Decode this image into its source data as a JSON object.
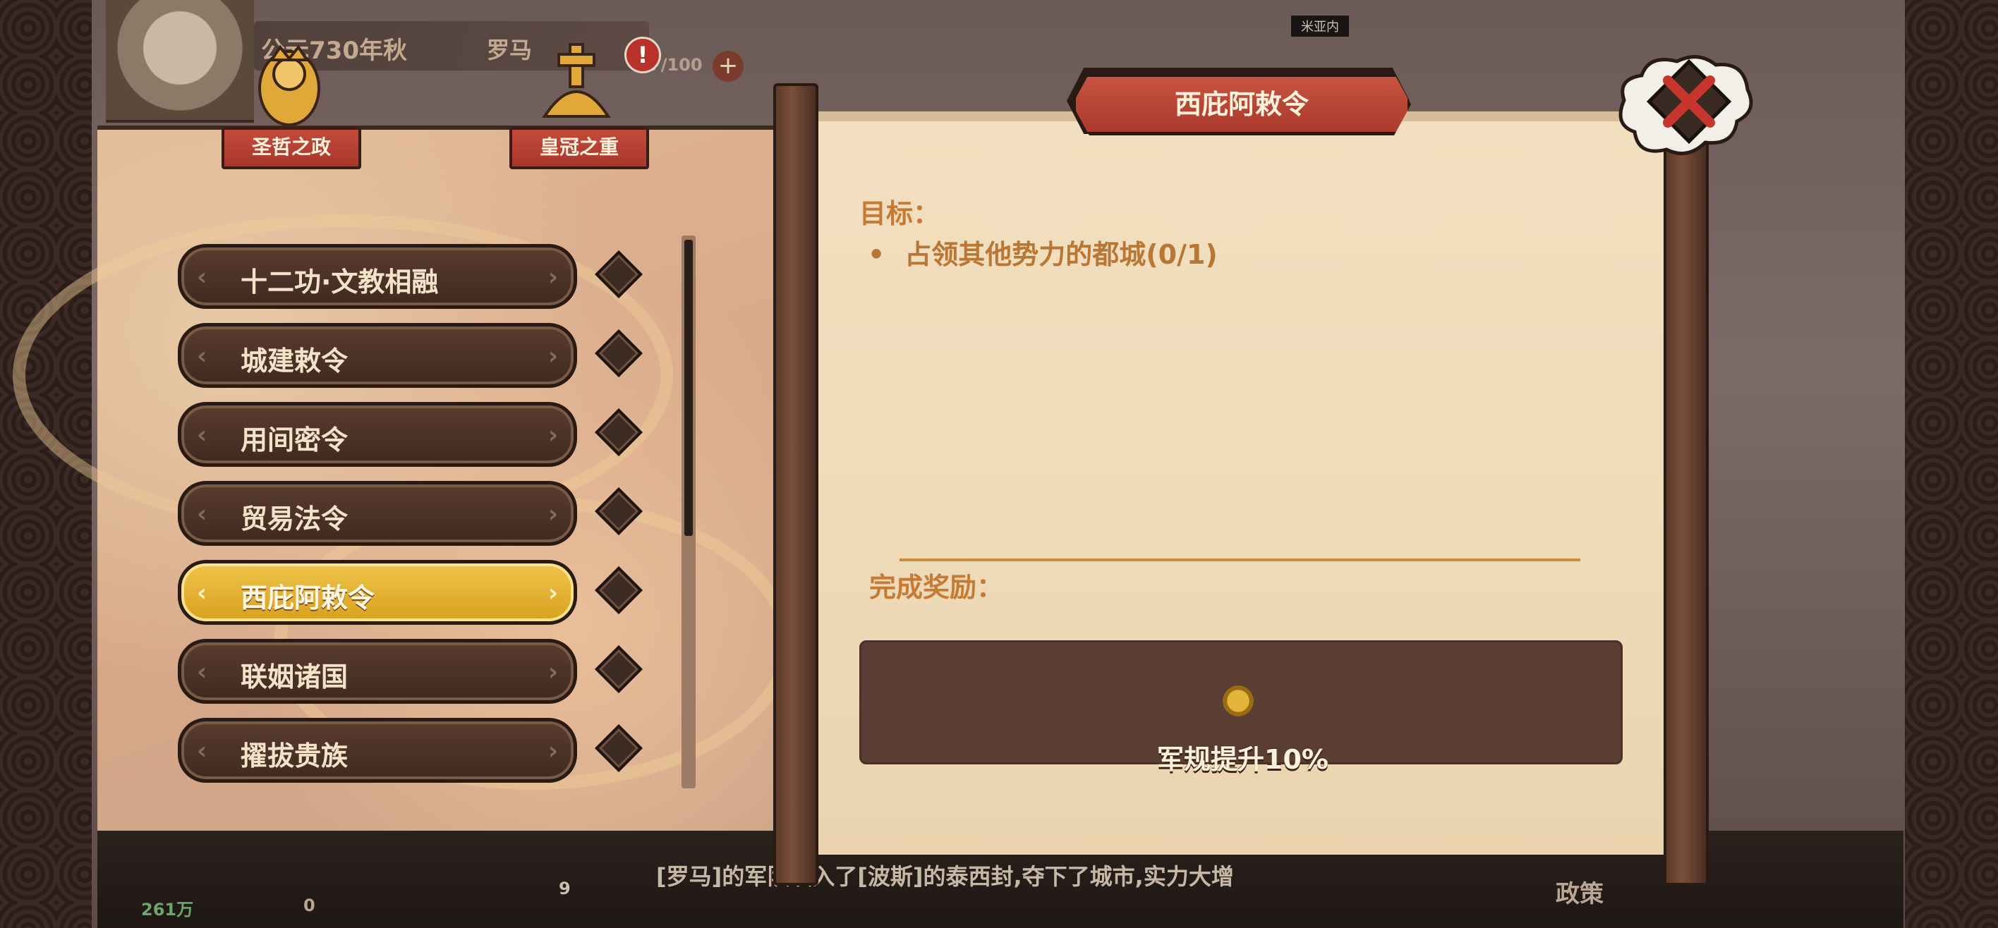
{
  "hud": {
    "date": "公元730年秋",
    "faction": "罗马",
    "resource_count": "7/100",
    "add_symbol": "+",
    "alert_symbol": "!",
    "map_label": "米亚内"
  },
  "tabs": [
    {
      "label": "圣哲之政"
    },
    {
      "label": "皇冠之重"
    }
  ],
  "edict_list": {
    "items": [
      {
        "label": "十二功·文教相融",
        "active": false
      },
      {
        "label": "城建敕令",
        "active": false
      },
      {
        "label": "用间密令",
        "active": false
      },
      {
        "label": "贸易法令",
        "active": false
      },
      {
        "label": "西庇阿敕令",
        "active": true
      },
      {
        "label": "联姻诸国",
        "active": false
      },
      {
        "label": "擢拔贵族",
        "active": false
      }
    ]
  },
  "detail": {
    "title": "西庇阿敕令",
    "goal_heading": "目标：",
    "goal_bullet": "•",
    "goals": [
      "占领其他势力的都城(0/1)"
    ],
    "reward_heading": "完成奖励：",
    "rewards": [
      "军规提升10%"
    ]
  },
  "bottom": {
    "news": "[罗马]的军队攻入了[波斯]的泰西封,夺下了城市,实力大增",
    "policy_label": "政策",
    "population": "261万",
    "soldiers": "0",
    "badge_num": "9"
  },
  "colors": {
    "accent_red": "#b5402f",
    "gold_active": "#e3b033",
    "panel_bg": "#f0dcba",
    "text_brown": "#c67b34"
  }
}
